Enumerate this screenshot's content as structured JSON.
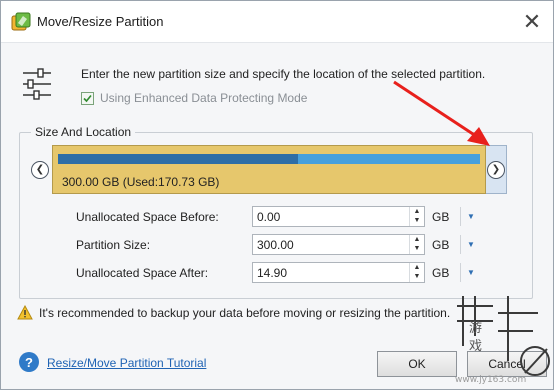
{
  "window": {
    "title": "Move/Resize Partition",
    "close_symbol": "✕"
  },
  "header": {
    "instruction": "Enter the new partition size and specify the location of the selected partition.",
    "enhanced_mode": {
      "label": "Using Enhanced Data Protecting Mode",
      "checked": true
    }
  },
  "size_location": {
    "legend": "Size And Location",
    "partition_label": "300.00 GB (Used:170.73 GB)",
    "used_fraction": 0.569,
    "colors": {
      "partition_fill": "#e6c76c",
      "used_bar": "#2e6ea6",
      "free_bar": "#46a0dc"
    }
  },
  "fields": {
    "unallocated_before": {
      "label": "Unallocated Space Before:",
      "value": "0.00",
      "unit": "GB"
    },
    "partition_size": {
      "label": "Partition Size:",
      "value": "300.00",
      "unit": "GB"
    },
    "unallocated_after": {
      "label": "Unallocated Space After:",
      "value": "14.90",
      "unit": "GB"
    }
  },
  "warning": {
    "text": "It's recommended to backup your data before moving or resizing the partition."
  },
  "footer": {
    "tutorial_link": "Resize/Move Partition Tutorial",
    "ok_label": "OK",
    "cancel_label": "Cancel"
  },
  "icons": {
    "app": "partition-wizard-icon",
    "settings": "sliders-icon",
    "warning": "warning-icon",
    "help": "help-icon",
    "nav_left": "chevron-left-icon",
    "nav_right": "chevron-right-icon"
  },
  "watermark": {
    "glyphs": [
      "游",
      "戏"
    ],
    "url": "www.jy163.com"
  }
}
